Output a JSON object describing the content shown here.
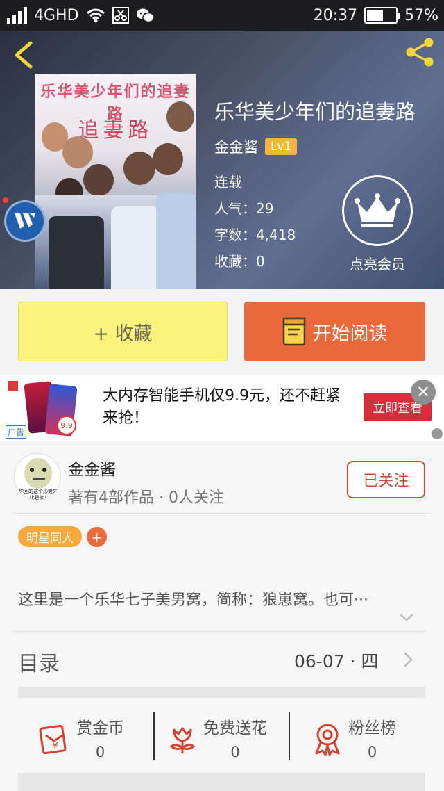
{
  "status_bar": {
    "network": "4GHD",
    "time": "20:37",
    "battery_pct": "57%",
    "battery_level": 0.57
  },
  "book": {
    "cover_title": "乐华美少年们的追妻路",
    "cover_subtitle": "追妻路",
    "title": "乐华美少年们的追妻路",
    "author": "金金酱",
    "level": "Lv1",
    "status": "连载",
    "popularity": "人气：29",
    "word_count": "字数：4,418",
    "favorites": "收藏：0",
    "vip_label": "点亮会员"
  },
  "actions": {
    "collect": "+ 收藏",
    "read": "开始阅读"
  },
  "ad": {
    "text": "大内存智能手机仅9.9元，还不赶紧来抢！",
    "cta": "立即查看",
    "tag": "广告",
    "badge": "9.9",
    "close": "✕"
  },
  "author_card": {
    "name": "金金酱",
    "subtitle": "著有4部作品 · 0人关注",
    "follow_label": "已关注",
    "avatar_caption_1": "你回的这个形势来",
    "avatar_caption_2": "化是笑?",
    "tag": "明星同人",
    "tag_add": "+",
    "description": "这里是一个乐华七子美男窝，简称：狼崽窝。也可···"
  },
  "toc": {
    "label": "目录",
    "date": "06-07 · 四"
  },
  "stats": [
    {
      "label": "赏金币",
      "value": "0",
      "icon": "coin-envelope-icon"
    },
    {
      "label": "免费送花",
      "value": "0",
      "icon": "flower-icon"
    },
    {
      "label": "粉丝榜",
      "value": "0",
      "icon": "ribbon-medal-icon"
    }
  ],
  "colors": {
    "accent_orange": "#e9693a",
    "collect_yellow": "#fbf37a",
    "follow_red": "#d2463c",
    "tag_orange": "#f7a93c",
    "icon_red": "#d9412f"
  }
}
